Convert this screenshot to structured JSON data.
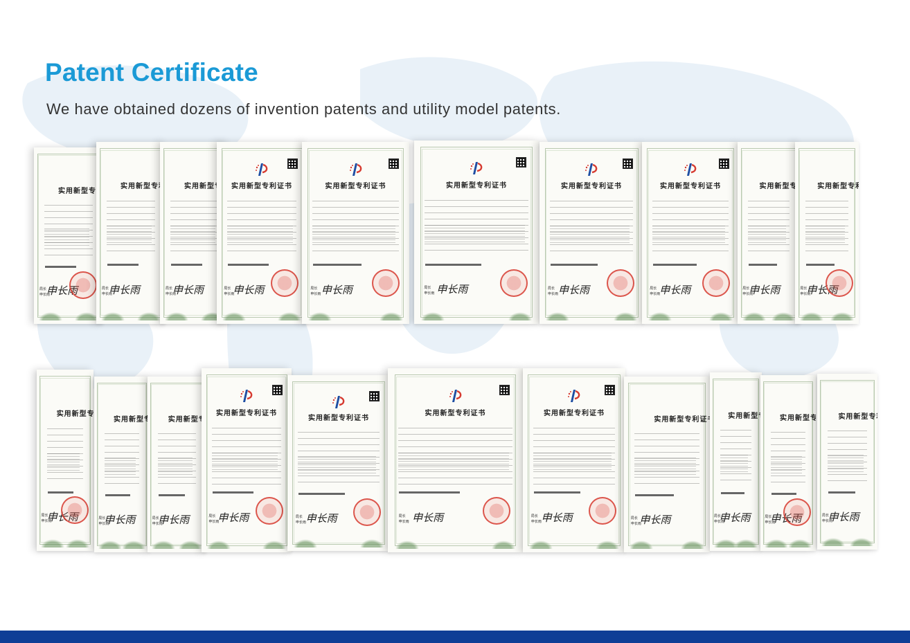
{
  "page": {
    "title": "Patent Certificate",
    "subtitle": "We have obtained dozens of invention patents and utility model patents."
  },
  "colors": {
    "title": "#1b9ad6",
    "subtitle": "#333333",
    "bottom_band": "#0f3e96",
    "seal": "#d63a30"
  },
  "certificate": {
    "heading": "实用新型专利证书",
    "signature": "申长雨",
    "sign_labels": [
      "局长",
      "申长雨"
    ],
    "icons": [
      "cnipa-logo-icon",
      "qr-code-icon",
      "official-seal-icon"
    ]
  },
  "rows": [
    {
      "name": "top-row",
      "count": 11
    },
    {
      "name": "bottom-row",
      "count": 12
    }
  ]
}
